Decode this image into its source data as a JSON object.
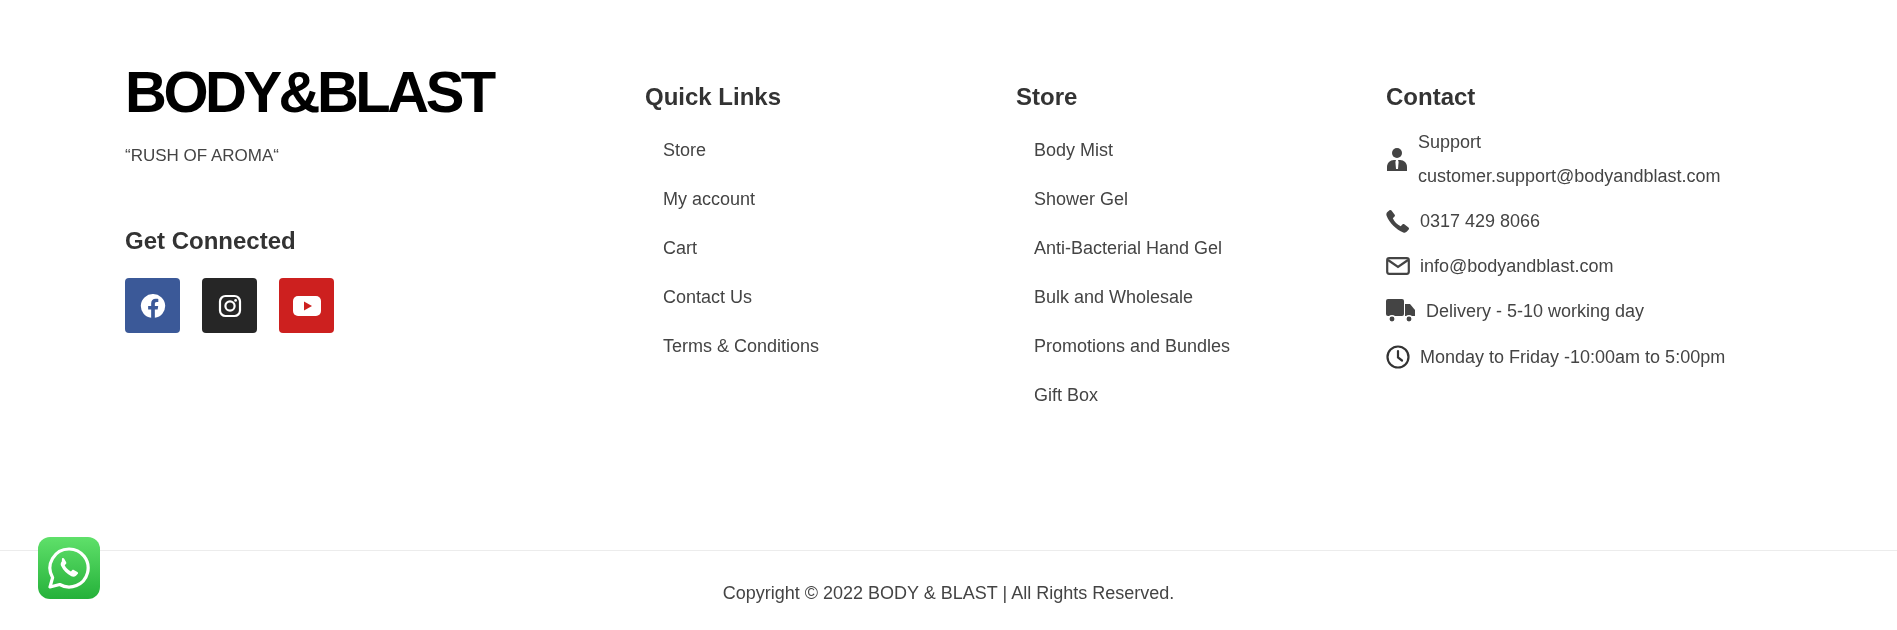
{
  "brand": {
    "logo": "BODY&BLAST",
    "tagline": "“RUSH OF AROMA“"
  },
  "social": {
    "title": "Get Connected",
    "links": [
      {
        "kind": "facebook",
        "color": "#3b5998"
      },
      {
        "kind": "instagram",
        "color": "#262626"
      },
      {
        "kind": "youtube",
        "color": "#cd201f"
      }
    ]
  },
  "quick_links": {
    "title": "Quick Links",
    "items": [
      "Store",
      "My account",
      "Cart",
      "Contact Us",
      "Terms & Conditions"
    ]
  },
  "store": {
    "title": "Store",
    "items": [
      "Body Mist",
      "Shower Gel",
      "Anti-Bacterial Hand Gel",
      "Bulk and Wholesale",
      "Promotions and Bundles",
      "Gift Box"
    ]
  },
  "contact": {
    "title": "Contact",
    "items": [
      {
        "kind": "person",
        "lines": [
          "Support",
          "customer.support@bodyandblast.com"
        ]
      },
      {
        "kind": "phone",
        "lines": [
          "0317 429 8066"
        ]
      },
      {
        "kind": "mail",
        "lines": [
          "info@bodyandblast.com"
        ]
      },
      {
        "kind": "truck",
        "lines": [
          "Delivery - 5-10 working day"
        ]
      },
      {
        "kind": "clock",
        "lines": [
          "Monday to Friday -10:00am to 5:00pm"
        ]
      }
    ]
  },
  "copyright": "Copyright © 2022 BODY & BLAST | All Rights Reserved.",
  "chat_button": {
    "kind": "whatsapp"
  }
}
